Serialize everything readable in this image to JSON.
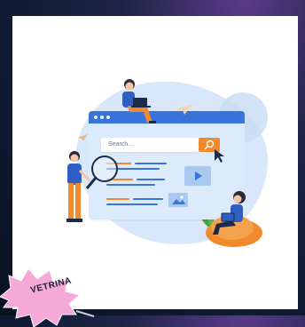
{
  "illustration": {
    "search_placeholder": "Search...",
    "colors": {
      "browser_bar": "#3a73d9",
      "search_button": "#f08a2c",
      "blob": "#d8e8fa",
      "person_shirt_blue": "#2f5fc4",
      "person_pants_orange": "#f08a2c"
    }
  },
  "badge": {
    "label": "VETRINA",
    "color": "#f4a9d6"
  }
}
